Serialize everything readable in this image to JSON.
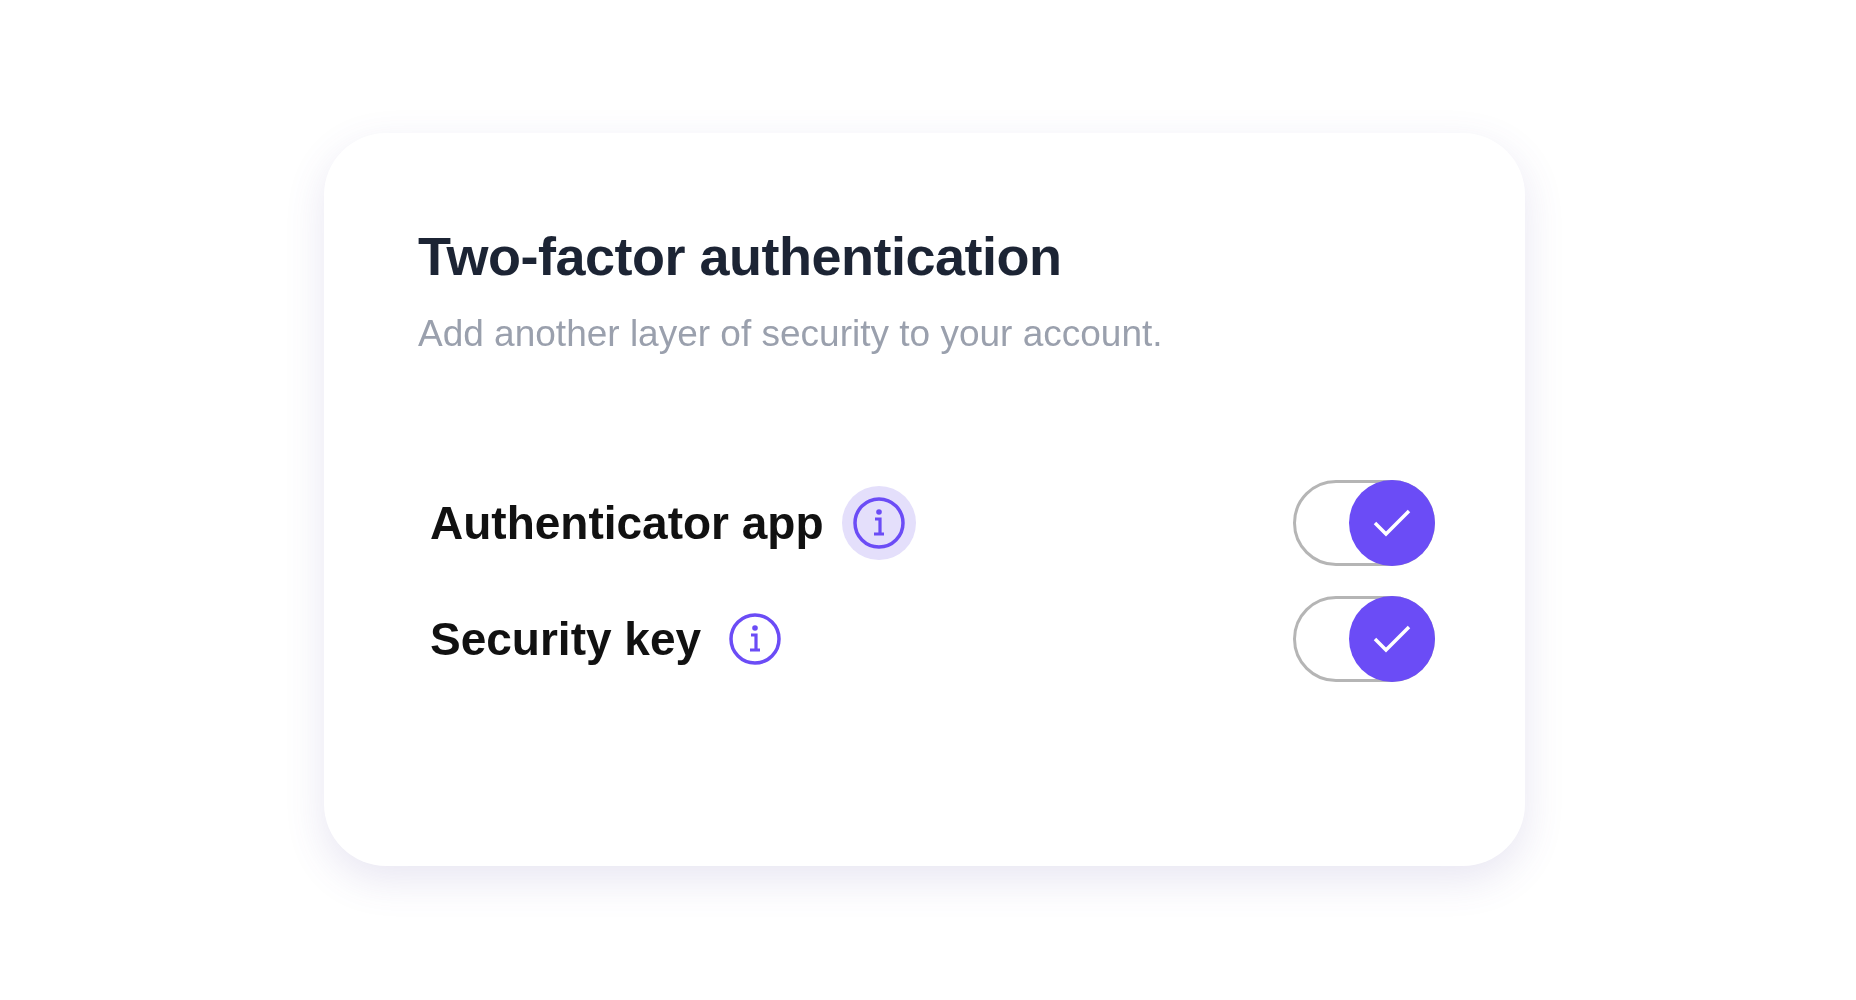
{
  "card": {
    "title": "Two-factor authentication",
    "subtitle": "Add another layer of security to your account."
  },
  "options": [
    {
      "label": "Authenticator app",
      "on": true,
      "info_focused": true
    },
    {
      "label": "Security key",
      "on": true,
      "info_focused": false
    }
  ]
}
